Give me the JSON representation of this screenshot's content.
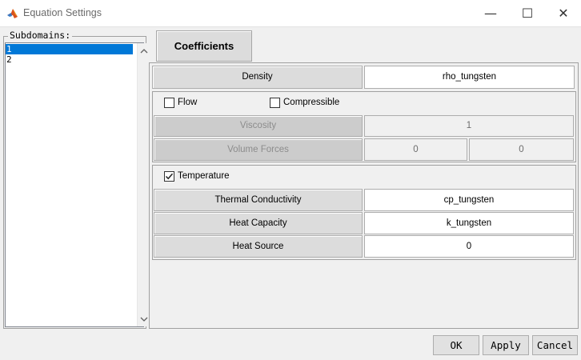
{
  "window": {
    "title": "Equation Settings",
    "min_symbol": "—",
    "max_symbol": "☐",
    "close_symbol": "✕",
    "icon": "matlab-logo-icon"
  },
  "subdomains": {
    "label": "Subdomains:",
    "items": [
      "1",
      "2"
    ],
    "selected": "1"
  },
  "tabs": {
    "coefficients": "Coefficients"
  },
  "density": {
    "label": "Density",
    "value": "rho_tungsten"
  },
  "flow": {
    "flow_label": "Flow",
    "flow_checked": false,
    "compressible_label": "Compressible",
    "compressible_checked": false,
    "viscosity_label": "Viscosity",
    "viscosity_value": "1",
    "volume_forces_label": "Volume Forces",
    "volume_forces_x": "0",
    "volume_forces_y": "0"
  },
  "temperature": {
    "label": "Temperature",
    "checked": true,
    "thermal_conductivity_label": "Thermal Conductivity",
    "thermal_conductivity_value": "cp_tungsten",
    "heat_capacity_label": "Heat Capacity",
    "heat_capacity_value": "k_tungsten",
    "heat_source_label": "Heat Source",
    "heat_source_value": "0"
  },
  "buttons": {
    "ok": "OK",
    "apply": "Apply",
    "cancel": "Cancel"
  },
  "colors": {
    "selection": "#0078d7",
    "background": "#f0f0f0",
    "title_bar": "#ffffff"
  }
}
